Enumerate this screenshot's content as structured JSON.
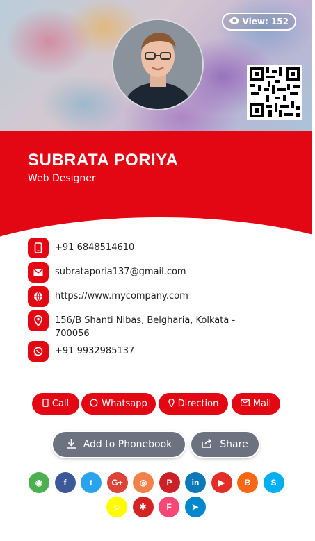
{
  "view": {
    "label": "View: 152"
  },
  "profile": {
    "name": "SUBRATA PORIYA",
    "role": "Web Designer"
  },
  "contacts": [
    {
      "icon": "phone-icon",
      "text": "+91 6848514610"
    },
    {
      "icon": "mail-icon",
      "text": "subrataporia137@gmail.com"
    },
    {
      "icon": "globe-icon",
      "text": "https://www.mycompany.com"
    },
    {
      "icon": "location-icon",
      "text": "156/B Shanti Nibas, Belgharia, Kolkata - 700056"
    },
    {
      "icon": "whatsapp-icon",
      "text": "+91 9932985137"
    }
  ],
  "actions": {
    "call": "Call",
    "whatsapp": "Whatsapp",
    "direction": "Direction",
    "mail": "Mail"
  },
  "secondary": {
    "phonebook": "Add to Phonebook",
    "share": "Share"
  },
  "social": [
    {
      "name": "whatsapp",
      "glyph": "◉",
      "color": "#4caf50"
    },
    {
      "name": "facebook",
      "glyph": "f",
      "color": "#3b5998"
    },
    {
      "name": "twitter",
      "glyph": "t",
      "color": "#2aa3ef"
    },
    {
      "name": "google-plus",
      "glyph": "G+",
      "color": "#db4437"
    },
    {
      "name": "instagram",
      "glyph": "◎",
      "color": "#f0814a"
    },
    {
      "name": "pinterest",
      "glyph": "P",
      "color": "#cb2027"
    },
    {
      "name": "linkedin",
      "glyph": "in",
      "color": "#0a79b7"
    },
    {
      "name": "youtube",
      "glyph": "▶",
      "color": "#e52d27"
    },
    {
      "name": "blogger",
      "glyph": "B",
      "color": "#fa6815"
    },
    {
      "name": "skype",
      "glyph": "S",
      "color": "#00aff0"
    },
    {
      "name": "snapchat",
      "glyph": "☺",
      "color": "#fffc00"
    },
    {
      "name": "yelp",
      "glyph": "✱",
      "color": "#d32323"
    },
    {
      "name": "foursquare",
      "glyph": "F",
      "color": "#f94877"
    },
    {
      "name": "telegram",
      "glyph": "➤",
      "color": "#0088cc"
    }
  ]
}
